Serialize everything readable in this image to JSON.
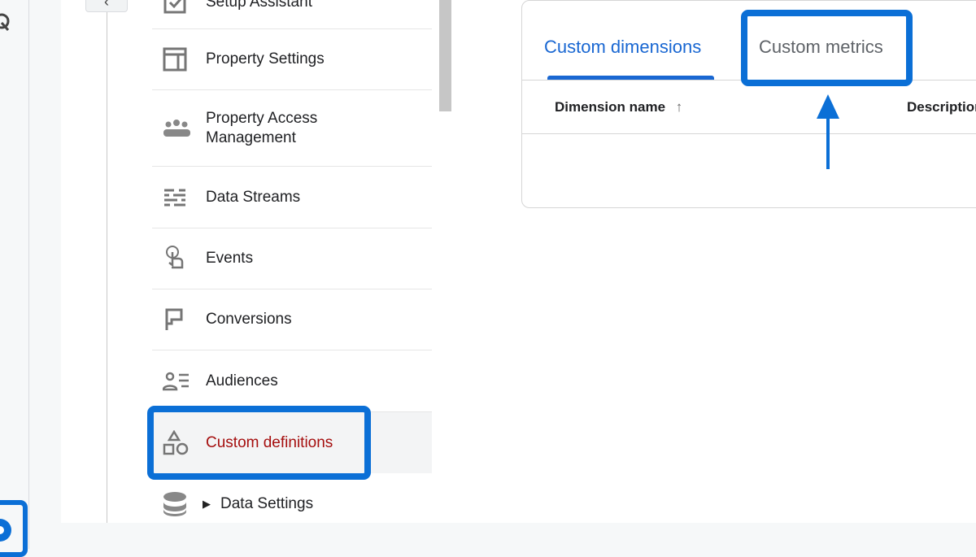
{
  "nav": {
    "back_icon": "chevron-left-icon",
    "items": [
      {
        "label": "Setup Assistant",
        "icon": "checkbox-icon"
      },
      {
        "label": "Property Settings",
        "icon": "layout-icon"
      },
      {
        "label": "Property Access Management",
        "icon": "people-icon"
      },
      {
        "label": "Data Streams",
        "icon": "streams-icon"
      },
      {
        "label": "Events",
        "icon": "touch-icon"
      },
      {
        "label": "Conversions",
        "icon": "flag-icon"
      },
      {
        "label": "Audiences",
        "icon": "audience-icon"
      },
      {
        "label": "Custom definitions",
        "icon": "shapes-icon",
        "active": true
      },
      {
        "label": "Data Settings",
        "icon": "database-icon"
      }
    ]
  },
  "card": {
    "tabs": [
      {
        "label": "Custom dimensions",
        "active": true
      },
      {
        "label": "Custom metrics"
      }
    ],
    "columns": [
      "Dimension name",
      "Description"
    ]
  },
  "colors": {
    "accent": "#1967d2",
    "annotation": "#0b6fd6",
    "active_text": "#a50e0e"
  }
}
